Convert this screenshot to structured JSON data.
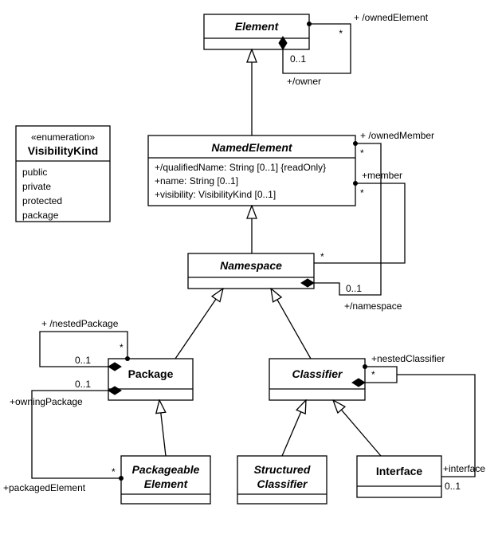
{
  "classes": {
    "element": {
      "name": "Element"
    },
    "namedElement": {
      "name": "NamedElement",
      "attrs": {
        "a1": "+/qualifiedName: String [0..1] {readOnly}",
        "a2": "+name: String [0..1]",
        "a3": "+visibility: VisibilityKind [0..1]"
      }
    },
    "namespace": {
      "name": "Namespace"
    },
    "visibilityKind": {
      "stereotype": "«enumeration»",
      "name": "VisibilityKind",
      "literals": {
        "l1": "public",
        "l2": "private",
        "l3": "protected",
        "l4": "package"
      }
    },
    "package": {
      "name": "Package"
    },
    "classifier": {
      "name": "Classifier"
    },
    "packageableElement": {
      "name1": "Packageable",
      "name2": "Element"
    },
    "structuredClassifier": {
      "name1": "Structured",
      "name2": "Classifier"
    },
    "interface": {
      "name": "Interface"
    }
  },
  "assoc": {
    "ownedElement": {
      "role": "+ /ownedElement",
      "mult": "*"
    },
    "owner": {
      "role": "+/owner",
      "mult": "0..1"
    },
    "ownedMember": {
      "role": "+ /ownedMember",
      "mult": "*"
    },
    "member": {
      "role": "+member",
      "mult": "*"
    },
    "namespaceEnd": {
      "role": "+/namespace",
      "mult": "0..1",
      "far": "*"
    },
    "nestedPackage": {
      "role": "+ /nestedPackage",
      "mult": "*",
      "ownerMult": "0..1"
    },
    "packagedElement": {
      "role": "+packagedElement",
      "mult": "*",
      "owner": "+owningPackage",
      "ownerMult": "0..1"
    },
    "nestedClassifier": {
      "role": "+nestedClassifier",
      "mult": "*"
    },
    "interfaceEnd": {
      "role": "+interface",
      "mult": "0..1"
    }
  }
}
